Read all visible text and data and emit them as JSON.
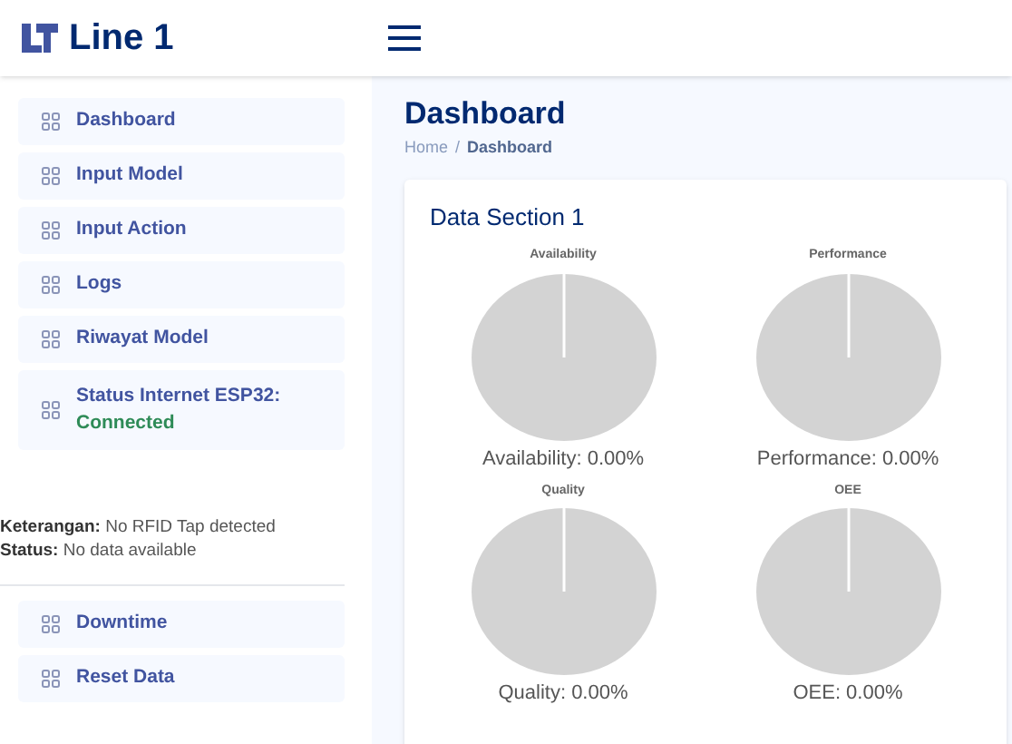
{
  "header": {
    "title": "Line 1"
  },
  "sidebar": {
    "items": [
      {
        "label": "Dashboard"
      },
      {
        "label": "Input Model"
      },
      {
        "label": "Input Action"
      },
      {
        "label": "Logs"
      },
      {
        "label": "Riwayat Model"
      },
      {
        "label": "Status Internet ESP32:",
        "status": "Connected"
      }
    ],
    "info": [
      "**Keterangan:** No RFID Tap detected",
      "**Status:** No data available"
    ],
    "bottom_items": [
      {
        "label": "Downtime"
      },
      {
        "label": "Reset Data"
      }
    ]
  },
  "page": {
    "title": "Dashboard",
    "breadcrumb": [
      "Home",
      "Dashboard"
    ],
    "breadcrumb_separator": "/"
  },
  "card": {
    "title": "Data Section 1",
    "charts": [
      {
        "title": "Availability",
        "caption": "Availability: 0.00%"
      },
      {
        "title": "Performance",
        "caption": "Performance: 0.00%"
      },
      {
        "title": "Quality",
        "caption": "Quality: 0.00%"
      },
      {
        "title": "OEE",
        "caption": "OEE: 0.00%"
      }
    ]
  }
}
